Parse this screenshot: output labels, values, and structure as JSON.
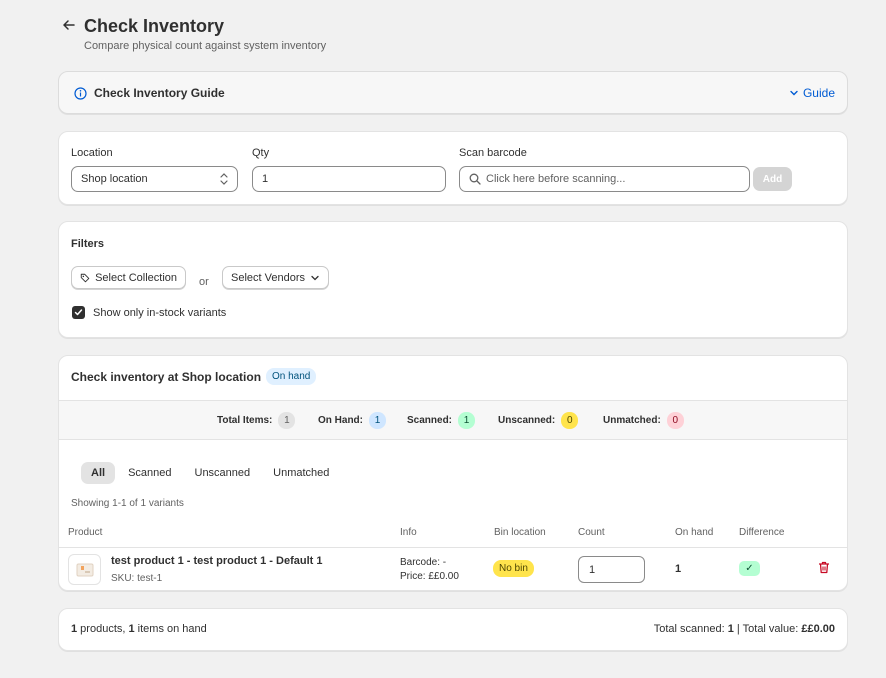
{
  "header": {
    "title": "Check Inventory",
    "subtitle": "Compare physical count against system inventory"
  },
  "guide": {
    "title": "Check Inventory Guide",
    "toggle_label": "Guide"
  },
  "location_form": {
    "location_label": "Location",
    "location_value": "Shop location",
    "qty_label": "Qty",
    "qty_value": "1",
    "scan_label": "Scan barcode",
    "scan_placeholder": "Click here before scanning...",
    "add_label": "Add"
  },
  "filters": {
    "title": "Filters",
    "collection_button": "Select Collection",
    "or_text": "or",
    "vendors_button": "Select Vendors",
    "instock_label": "Show only in-stock variants",
    "instock_checked": true
  },
  "inventory": {
    "title": "Check inventory at Shop location",
    "badge": "On hand",
    "stats": [
      {
        "label": "Total Items:",
        "value": "1"
      },
      {
        "label": "On Hand:",
        "value": "1"
      },
      {
        "label": "Scanned:",
        "value": "1"
      },
      {
        "label": "Unscanned:",
        "value": "0"
      },
      {
        "label": "Unmatched:",
        "value": "0"
      }
    ],
    "tabs": [
      "All",
      "Scanned",
      "Unscanned",
      "Unmatched"
    ],
    "active_tab": "All",
    "showing": "Showing 1-1 of 1 variants",
    "columns": [
      "Product",
      "Info",
      "Bin location",
      "Count",
      "On hand",
      "Difference"
    ],
    "rows": [
      {
        "product": "test product 1 - test product 1 - Default 1",
        "sku": "SKU: test-1",
        "barcode": "Barcode: -",
        "price": "Price: ££0.00",
        "bin": "No bin",
        "count": "1",
        "on_hand": "1",
        "difference": "✓"
      }
    ]
  },
  "summary": {
    "products_count": "1",
    "products_text": " products, ",
    "items_count": "1",
    "items_text": " items on hand",
    "scanned_label": "Total scanned: ",
    "scanned_value": "1",
    "separator": " | ",
    "value_label": "Total value: ",
    "value_amount": "££0.00"
  },
  "colors": {
    "accent_link": "#005bd3",
    "badge_info": "#e0f0ff",
    "badge_success": "#b4fed2",
    "badge_warning": "#ffe44c",
    "badge_critical": "#fed1d7"
  }
}
